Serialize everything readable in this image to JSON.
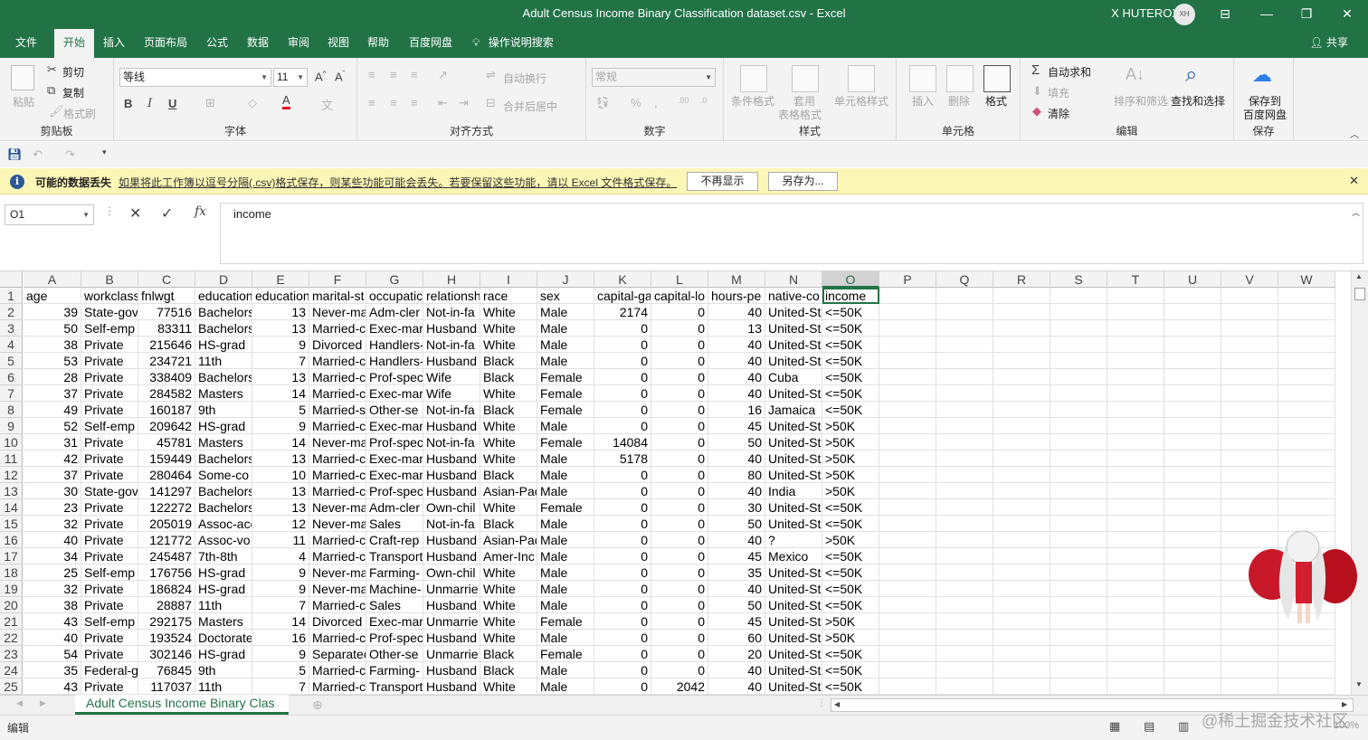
{
  "window": {
    "title": "Adult Census Income Binary Classification dataset.csv  -  Excel",
    "user": "X HUTEROX",
    "avatar_initials": "XH"
  },
  "tabs": [
    "文件",
    "开始",
    "插入",
    "页面布局",
    "公式",
    "数据",
    "审阅",
    "视图",
    "帮助",
    "百度网盘"
  ],
  "active_tab": "开始",
  "tell_me": "操作说明搜索",
  "share": "共享",
  "ribbon": {
    "clipboard": {
      "paste": "粘贴",
      "cut": "剪切",
      "copy": "复制",
      "format_painter": "格式刷",
      "label": "剪贴板"
    },
    "font": {
      "name": "等线",
      "size": "11",
      "label": "字体"
    },
    "alignment": {
      "wrap": "自动换行",
      "merge": "合并后居中",
      "label": "对齐方式"
    },
    "number": {
      "format": "常规",
      "label": "数字"
    },
    "styles": {
      "conditional": "条件格式",
      "table1": "套用",
      "table2": "表格格式",
      "cell": "单元格样式",
      "label": "样式"
    },
    "cells": {
      "insert": "插入",
      "delete": "删除",
      "format": "格式",
      "label": "单元格"
    },
    "editing": {
      "autosum": "自动求和",
      "fill": "填充",
      "clear": "清除",
      "sort": "排序和筛选",
      "find": "查找和选择",
      "label": "编辑"
    },
    "save": {
      "line1": "保存到",
      "line2": "百度网盘",
      "label": "保存"
    }
  },
  "message_bar": {
    "title": "可能的数据丢失",
    "text": "如果将此工作簿以逗号分隔(.csv)格式保存，则某些功能可能会丢失。若要保留这些功能，请以 Excel 文件格式保存。",
    "btn_dismiss": "不再显示",
    "btn_save_as": "另存为..."
  },
  "formula_bar": {
    "name_box": "O1",
    "content": "income"
  },
  "columns": [
    "A",
    "B",
    "C",
    "D",
    "E",
    "F",
    "G",
    "H",
    "I",
    "J",
    "K",
    "L",
    "M",
    "N",
    "O",
    "P",
    "Q",
    "R",
    "S",
    "T",
    "U",
    "V",
    "W"
  ],
  "selected_column": "O",
  "header_row": [
    "age",
    "workclass",
    "fnlwgt",
    "education",
    "education",
    "marital-st",
    "occupatic",
    "relationsh",
    "race",
    "sex",
    "capital-ga",
    "capital-lo",
    "hours-pe",
    "native-co",
    "income"
  ],
  "rows": [
    [
      "39",
      "State-gov",
      "77516",
      "Bachelors",
      "13",
      "Never-ma",
      "Adm-cler",
      "Not-in-fa",
      "White",
      "Male",
      "2174",
      "0",
      "40",
      "United-St",
      "<=50K"
    ],
    [
      "50",
      "Self-emp",
      "83311",
      "Bachelors",
      "13",
      "Married-c",
      "Exec-mar",
      "Husband",
      "White",
      "Male",
      "0",
      "0",
      "13",
      "United-St",
      "<=50K"
    ],
    [
      "38",
      "Private",
      "215646",
      "HS-grad",
      "9",
      "Divorced",
      "Handlers-",
      "Not-in-fa",
      "White",
      "Male",
      "0",
      "0",
      "40",
      "United-St",
      "<=50K"
    ],
    [
      "53",
      "Private",
      "234721",
      "11th",
      "7",
      "Married-c",
      "Handlers-",
      "Husband",
      "Black",
      "Male",
      "0",
      "0",
      "40",
      "United-St",
      "<=50K"
    ],
    [
      "28",
      "Private",
      "338409",
      "Bachelors",
      "13",
      "Married-c",
      "Prof-spec",
      "Wife",
      "Black",
      "Female",
      "0",
      "0",
      "40",
      "Cuba",
      "<=50K"
    ],
    [
      "37",
      "Private",
      "284582",
      "Masters",
      "14",
      "Married-c",
      "Exec-mar",
      "Wife",
      "White",
      "Female",
      "0",
      "0",
      "40",
      "United-St",
      "<=50K"
    ],
    [
      "49",
      "Private",
      "160187",
      "9th",
      "5",
      "Married-s",
      "Other-se",
      "Not-in-fa",
      "Black",
      "Female",
      "0",
      "0",
      "16",
      "Jamaica",
      "<=50K"
    ],
    [
      "52",
      "Self-emp",
      "209642",
      "HS-grad",
      "9",
      "Married-c",
      "Exec-mar",
      "Husband",
      "White",
      "Male",
      "0",
      "0",
      "45",
      "United-St",
      ">50K"
    ],
    [
      "31",
      "Private",
      "45781",
      "Masters",
      "14",
      "Never-ma",
      "Prof-spec",
      "Not-in-fa",
      "White",
      "Female",
      "14084",
      "0",
      "50",
      "United-St",
      ">50K"
    ],
    [
      "42",
      "Private",
      "159449",
      "Bachelors",
      "13",
      "Married-c",
      "Exec-mar",
      "Husband",
      "White",
      "Male",
      "5178",
      "0",
      "40",
      "United-St",
      ">50K"
    ],
    [
      "37",
      "Private",
      "280464",
      "Some-co",
      "10",
      "Married-c",
      "Exec-mar",
      "Husband",
      "Black",
      "Male",
      "0",
      "0",
      "80",
      "United-St",
      ">50K"
    ],
    [
      "30",
      "State-gov",
      "141297",
      "Bachelors",
      "13",
      "Married-c",
      "Prof-spec",
      "Husband",
      "Asian-Pac",
      "Male",
      "0",
      "0",
      "40",
      "India",
      ">50K"
    ],
    [
      "23",
      "Private",
      "122272",
      "Bachelors",
      "13",
      "Never-ma",
      "Adm-cler",
      "Own-chil",
      "White",
      "Female",
      "0",
      "0",
      "30",
      "United-St",
      "<=50K"
    ],
    [
      "32",
      "Private",
      "205019",
      "Assoc-acc",
      "12",
      "Never-ma",
      "Sales",
      "Not-in-fa",
      "Black",
      "Male",
      "0",
      "0",
      "50",
      "United-St",
      "<=50K"
    ],
    [
      "40",
      "Private",
      "121772",
      "Assoc-vo",
      "11",
      "Married-c",
      "Craft-rep",
      "Husband",
      "Asian-Pac",
      "Male",
      "0",
      "0",
      "40",
      "?",
      ">50K"
    ],
    [
      "34",
      "Private",
      "245487",
      "7th-8th",
      "4",
      "Married-c",
      "Transport",
      "Husband",
      "Amer-Inc",
      "Male",
      "0",
      "0",
      "45",
      "Mexico",
      "<=50K"
    ],
    [
      "25",
      "Self-emp",
      "176756",
      "HS-grad",
      "9",
      "Never-ma",
      "Farming-",
      "Own-chil",
      "White",
      "Male",
      "0",
      "0",
      "35",
      "United-St",
      "<=50K"
    ],
    [
      "32",
      "Private",
      "186824",
      "HS-grad",
      "9",
      "Never-ma",
      "Machine-",
      "Unmarrie",
      "White",
      "Male",
      "0",
      "0",
      "40",
      "United-St",
      "<=50K"
    ],
    [
      "38",
      "Private",
      "28887",
      "11th",
      "7",
      "Married-c",
      "Sales",
      "Husband",
      "White",
      "Male",
      "0",
      "0",
      "50",
      "United-St",
      "<=50K"
    ],
    [
      "43",
      "Self-emp",
      "292175",
      "Masters",
      "14",
      "Divorced",
      "Exec-mar",
      "Unmarrie",
      "White",
      "Female",
      "0",
      "0",
      "45",
      "United-St",
      ">50K"
    ],
    [
      "40",
      "Private",
      "193524",
      "Doctorate",
      "16",
      "Married-c",
      "Prof-spec",
      "Husband",
      "White",
      "Male",
      "0",
      "0",
      "60",
      "United-St",
      ">50K"
    ],
    [
      "54",
      "Private",
      "302146",
      "HS-grad",
      "9",
      "Separatec",
      "Other-se",
      "Unmarrie",
      "Black",
      "Female",
      "0",
      "0",
      "20",
      "United-St",
      "<=50K"
    ],
    [
      "35",
      "Federal-g",
      "76845",
      "9th",
      "5",
      "Married-c",
      "Farming-",
      "Husband",
      "Black",
      "Male",
      "0",
      "0",
      "40",
      "United-St",
      "<=50K"
    ],
    [
      "43",
      "Private",
      "117037",
      "11th",
      "7",
      "Married-c",
      "Transport",
      "Husband",
      "White",
      "Male",
      "0",
      "2042",
      "40",
      "United-St",
      "<=50K"
    ]
  ],
  "sheet_tab": "Adult Census Income Binary Clas",
  "status": {
    "mode": "编辑",
    "watermark": "@稀土掘金技术社区",
    "zoom": "100%"
  },
  "colors": {
    "excel_green": "#217346",
    "message_bar": "#fcf7b6"
  }
}
